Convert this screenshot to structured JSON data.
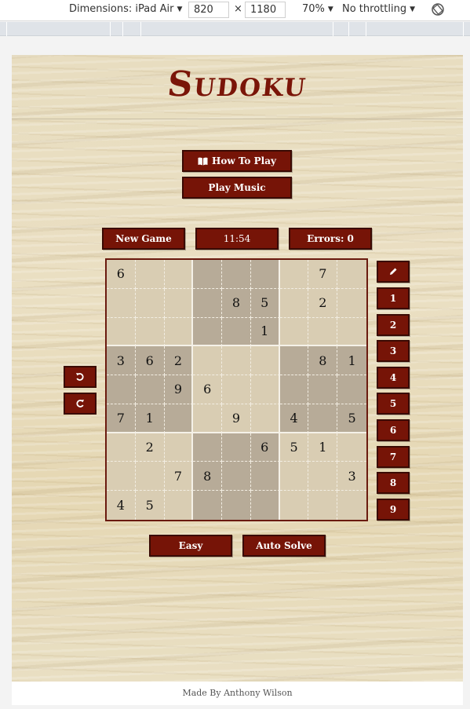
{
  "devtools": {
    "dimensions_label": "Dimensions: iPad Air",
    "width": "820",
    "times": "×",
    "height": "1180",
    "zoom": "70%",
    "throttling": "No throttling"
  },
  "app": {
    "title": "Sudoku",
    "how_to_play": "How To Play",
    "play_music": "Play Music",
    "new_game": "New Game",
    "timer": "11:54",
    "errors": "Errors: 0",
    "difficulty": "Easy",
    "auto_solve": "Auto Solve",
    "footer": "Made By Anthony Wilson",
    "accent_color": "#761407"
  },
  "board": [
    [
      "6",
      "",
      "",
      "",
      "",
      "",
      "",
      "7",
      ""
    ],
    [
      "",
      "",
      "",
      "",
      "8",
      "5",
      "",
      "2",
      ""
    ],
    [
      "",
      "",
      "",
      "",
      "",
      "1",
      "",
      "",
      ""
    ],
    [
      "3",
      "6",
      "2",
      "",
      "",
      "",
      "",
      "8",
      "1"
    ],
    [
      "",
      "",
      "9",
      "6",
      "",
      "",
      "",
      "",
      ""
    ],
    [
      "7",
      "1",
      "",
      "",
      "9",
      "",
      "4",
      "",
      "5"
    ],
    [
      "",
      "2",
      "",
      "",
      "",
      "6",
      "5",
      "1",
      ""
    ],
    [
      "",
      "",
      "7",
      "8",
      "",
      "",
      "",
      "",
      "3"
    ],
    [
      "4",
      "5",
      "",
      "",
      "",
      "",
      "",
      "",
      ""
    ]
  ],
  "number_buttons": [
    "1",
    "2",
    "3",
    "4",
    "5",
    "6",
    "7",
    "8",
    "9"
  ]
}
